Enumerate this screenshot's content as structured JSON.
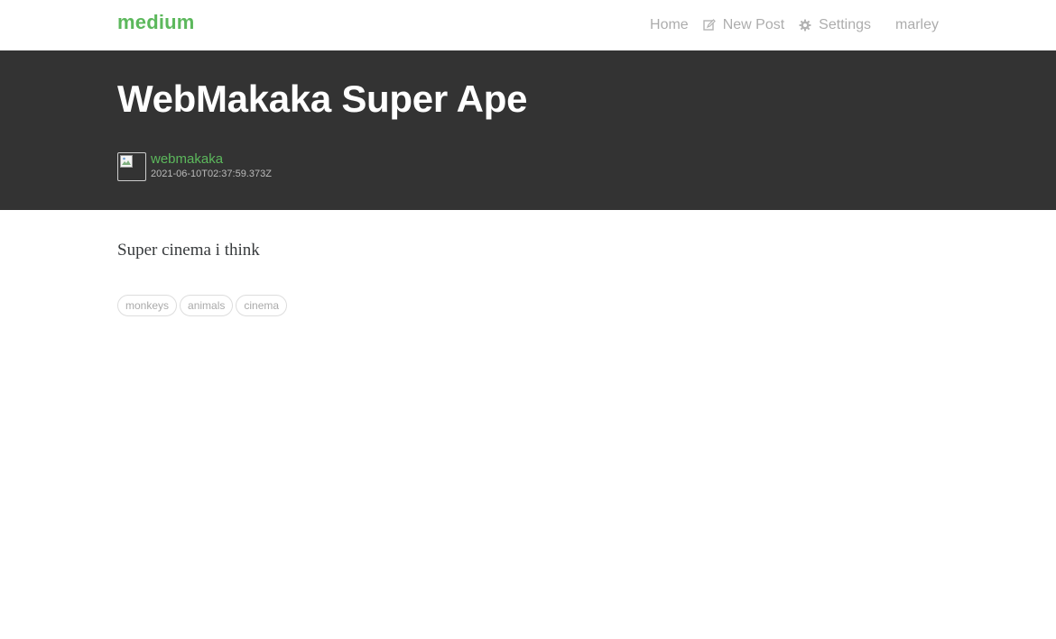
{
  "navbar": {
    "brand": "medium",
    "links": {
      "home": "Home",
      "new_post": "New Post",
      "settings": "Settings",
      "user": "marley"
    },
    "icons": {
      "new_post": "edit-icon",
      "settings": "gear-icon"
    }
  },
  "article": {
    "title": "WebMakaka Super Ape",
    "author": "webmakaka",
    "date": "2021-06-10T02:37:59.373Z",
    "avatar_icon": "broken-image-icon",
    "body": "Super cinema i think",
    "tags": [
      "monkeys",
      "animals",
      "cinema"
    ]
  },
  "colors": {
    "brand": "#5cb85c",
    "banner": "#333333",
    "nav_text": "#b3b3b3",
    "tag_border": "#dddddd",
    "tag_text": "#aaaaaa"
  }
}
